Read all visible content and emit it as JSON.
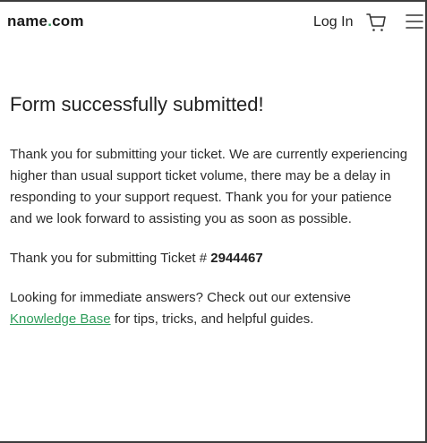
{
  "header": {
    "logo_name": "name",
    "logo_dot": ".",
    "logo_tld": "com",
    "login_label": "Log In",
    "cart_icon": "cart-icon",
    "menu_icon": "hamburger-menu-icon"
  },
  "main": {
    "title": "Form successfully submitted!",
    "message": "Thank you for submitting your ticket. We are currently experiencing higher than usual support ticket volume, there may be a delay in responding to your support request. Thank you for your patience and we look forward to assisting you as soon as possible.",
    "ticket_prefix": "Thank you for submitting Ticket # ",
    "ticket_number": "2944467",
    "help_prefix": "Looking for immediate answers? Check out our extensive ",
    "kb_link_label": "Knowledge Base",
    "help_suffix": " for tips, tricks, and helpful guides."
  },
  "colors": {
    "accent_green": "#2e9d5b",
    "text": "#2b2b2b"
  }
}
